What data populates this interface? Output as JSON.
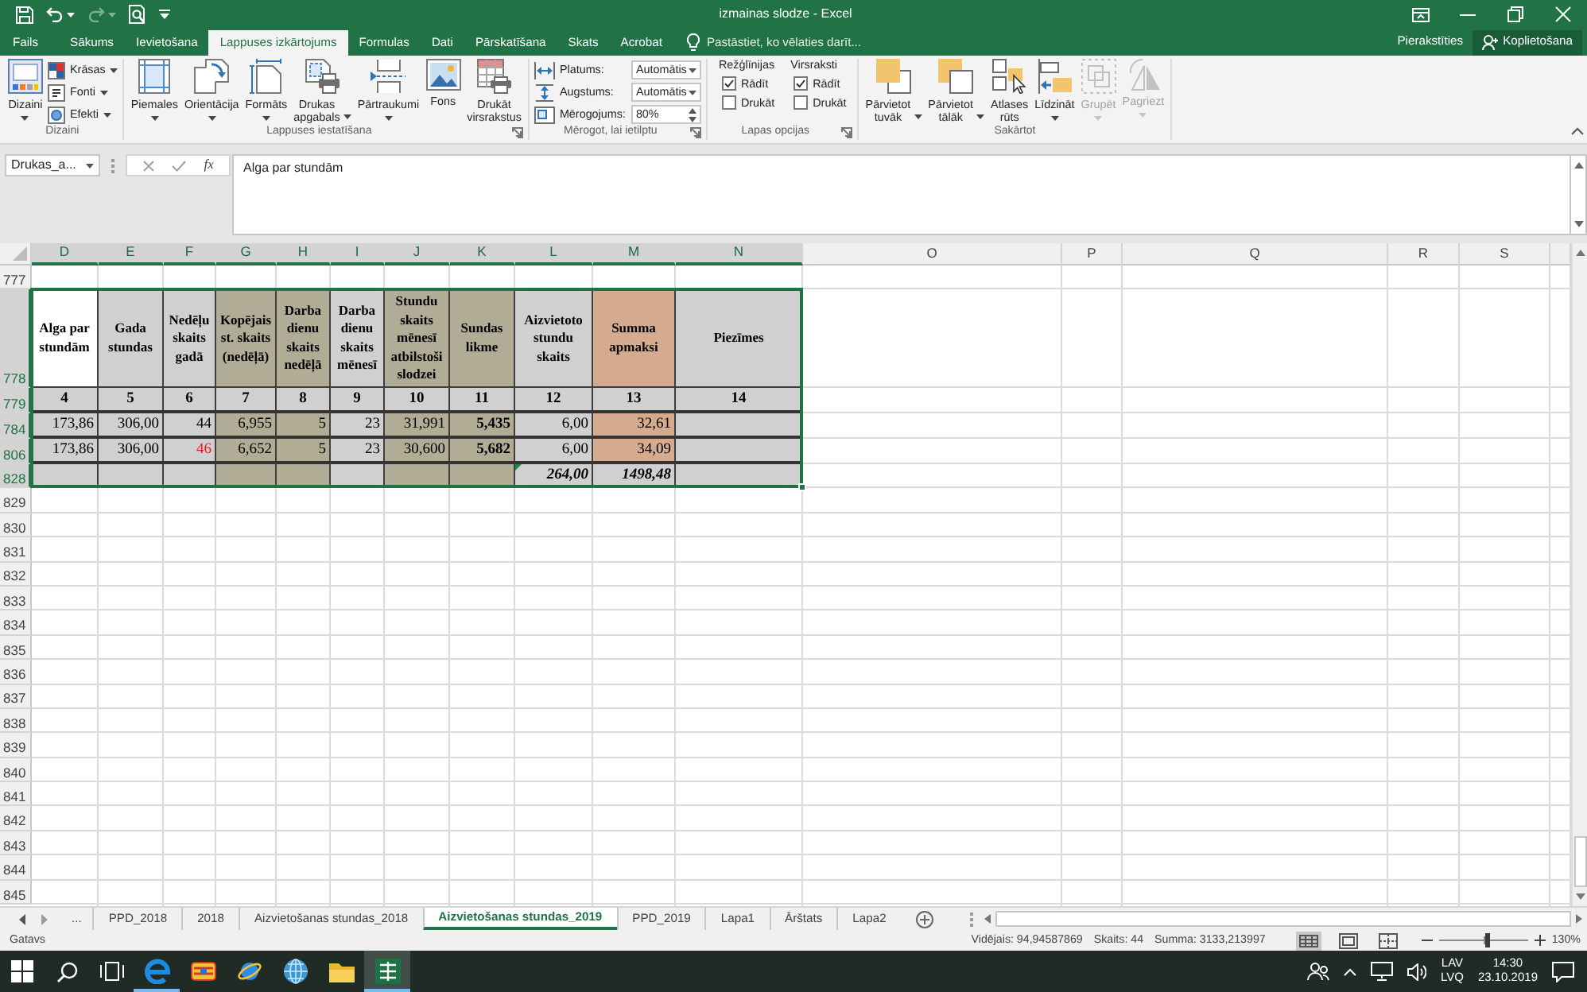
{
  "window": {
    "title": "izmainas slodze - Excel"
  },
  "quick_access": [
    {
      "disabled": false
    },
    {
      "disabled": false
    },
    {
      "disabled": true
    },
    {
      "disabled": false
    }
  ],
  "menu_tabs": [
    {
      "label": "Fails",
      "selected": false
    },
    {
      "label": "Sākums",
      "selected": false
    },
    {
      "label": "Ievietošana",
      "selected": false
    },
    {
      "label": "Lappuses izkārtojums",
      "selected": true
    },
    {
      "label": "Formulas",
      "selected": false
    },
    {
      "label": "Dati",
      "selected": false
    },
    {
      "label": "Pārskatīšana",
      "selected": false
    },
    {
      "label": "Skats",
      "selected": false
    },
    {
      "label": "Acrobat",
      "selected": false
    }
  ],
  "tell_me": {
    "placeholder": "Pastāstiet, ko vēlaties darīt..."
  },
  "account": {
    "sign_in": "Pierakstīties",
    "share": "Koplietošana"
  },
  "ribbon": {
    "groups": [
      {
        "label": "Dizaini",
        "launcher": false,
        "items": [
          {
            "kind": "large",
            "label": "Dizaini",
            "dropdown": true,
            "disabled": false
          },
          {
            "kind": "small",
            "label": "Krāsas",
            "dropdown": true,
            "disabled": false
          },
          {
            "kind": "small",
            "label": "Fonti",
            "dropdown": true,
            "disabled": false
          },
          {
            "kind": "small",
            "label": "Efekti",
            "dropdown": true,
            "disabled": false
          }
        ]
      },
      {
        "label": "Lappuses iestatīšana",
        "launcher": true,
        "items": [
          {
            "kind": "large",
            "label": "Piemales",
            "dropdown": true,
            "disabled": false
          },
          {
            "kind": "large",
            "label": "Orientācija",
            "dropdown": true,
            "disabled": false
          },
          {
            "kind": "large",
            "label": "Formāts",
            "dropdown": true,
            "disabled": false
          },
          {
            "kind": "large",
            "label": "Drukas apgabals",
            "dropdown": true,
            "disabled": false
          },
          {
            "kind": "large",
            "label": "Pārtraukumi",
            "dropdown": true,
            "disabled": false
          },
          {
            "kind": "large",
            "label": "Fons",
            "dropdown": false,
            "disabled": false
          },
          {
            "kind": "large",
            "label": "Drukāt virsrakstus",
            "dropdown": false,
            "disabled": false
          }
        ]
      },
      {
        "label": "Mērogot, lai ietilptu",
        "launcher": true,
        "items": [
          {
            "kind": "select",
            "label": "Platums:",
            "value": "Automātis"
          },
          {
            "kind": "select",
            "label": "Augstums:",
            "value": "Automātis"
          },
          {
            "kind": "spinner",
            "label": "Mērogojums:",
            "value": "80%"
          }
        ]
      },
      {
        "label": "Lapas opcijas",
        "launcher": true,
        "items": [
          {
            "kind": "checks",
            "heading": "Režģlīnijas",
            "options": [
              {
                "label": "Rādīt",
                "checked": true
              },
              {
                "label": "Drukāt",
                "checked": false
              }
            ]
          },
          {
            "kind": "checks",
            "heading": "Virsraksti",
            "options": [
              {
                "label": "Rādīt",
                "checked": true
              },
              {
                "label": "Drukāt",
                "checked": false
              }
            ]
          }
        ]
      },
      {
        "label": "Sakārtot",
        "launcher": false,
        "items": [
          {
            "kind": "large",
            "label": "Pārvietot tuvāk",
            "dropdown": true,
            "disabled": false
          },
          {
            "kind": "large",
            "label": "Pārvietot tālāk",
            "dropdown": true,
            "disabled": false
          },
          {
            "kind": "large",
            "label": "Atlases rūts",
            "dropdown": false,
            "disabled": false
          },
          {
            "kind": "large",
            "label": "Līdzināt",
            "dropdown": true,
            "disabled": false
          },
          {
            "kind": "large",
            "label": "Grupēt",
            "dropdown": true,
            "disabled": true
          },
          {
            "kind": "large",
            "label": "Pagriezt",
            "dropdown": true,
            "disabled": true
          }
        ]
      }
    ]
  },
  "formula_bar": {
    "name_box": "Drukas_a...",
    "function_button": "fx",
    "formula": "Alga par stundām"
  },
  "sheet": {
    "columns": [
      {
        "letter": "D",
        "selected": true
      },
      {
        "letter": "E",
        "selected": true
      },
      {
        "letter": "F",
        "selected": true
      },
      {
        "letter": "G",
        "selected": true
      },
      {
        "letter": "H",
        "selected": true
      },
      {
        "letter": "I",
        "selected": true
      },
      {
        "letter": "J",
        "selected": true
      },
      {
        "letter": "K",
        "selected": true
      },
      {
        "letter": "L",
        "selected": true
      },
      {
        "letter": "M",
        "selected": true
      },
      {
        "letter": "N",
        "selected": true
      },
      {
        "letter": "O",
        "selected": false
      },
      {
        "letter": "P",
        "selected": false
      },
      {
        "letter": "Q",
        "selected": false
      },
      {
        "letter": "R",
        "selected": false
      },
      {
        "letter": "S",
        "selected": false
      }
    ],
    "rows": [
      {
        "number": "777",
        "selected": false,
        "kind": "blank"
      },
      {
        "number": "778",
        "selected": true,
        "kind": "header",
        "cells": [
          {
            "text": "Alga par stundām",
            "color": "#ffffff"
          },
          {
            "text": "Gada stundas",
            "color": "#d0d0d0"
          },
          {
            "text": "Nedēļu skaits gadā",
            "color": "#d0d0d0"
          },
          {
            "text": "Kopējais st. skaits (nedēļā)",
            "color": "#b1ac96"
          },
          {
            "text": "Darba dienu skaits nedēļā",
            "color": "#b1ac96"
          },
          {
            "text": "Darba dienu skaits mēnesī",
            "color": "#d0d0d0"
          },
          {
            "text": "Stundu skaits mēnesī atbilstoši slodzei",
            "color": "#b1ac96"
          },
          {
            "text": "Sundas likme",
            "color": "#b1ac96"
          },
          {
            "text": "Aizvietoto stundu skaits",
            "color": "#d0d0d0"
          },
          {
            "text": "Summa apmaksi",
            "color": "#d5ab8f"
          },
          {
            "text": "Piezīmes",
            "color": "#d0d0d0"
          }
        ]
      },
      {
        "number": "779",
        "selected": true,
        "kind": "index",
        "cells": [
          {
            "text": "4",
            "color": "#d0d0d0"
          },
          {
            "text": "5",
            "color": "#d0d0d0"
          },
          {
            "text": "6",
            "color": "#d0d0d0"
          },
          {
            "text": "7",
            "color": "#d0d0d0"
          },
          {
            "text": "8",
            "color": "#d0d0d0"
          },
          {
            "text": "9",
            "color": "#d0d0d0"
          },
          {
            "text": "10",
            "color": "#d0d0d0"
          },
          {
            "text": "11",
            "color": "#d0d0d0"
          },
          {
            "text": "12",
            "color": "#d0d0d0"
          },
          {
            "text": "13",
            "color": "#d0d0d0"
          },
          {
            "text": "14",
            "color": "#d0d0d0"
          }
        ]
      },
      {
        "number": "784",
        "selected": true,
        "kind": "data",
        "cells": [
          {
            "text": "173,86",
            "color": "#d0d0d0",
            "kind": "plain"
          },
          {
            "text": "306,00",
            "color": "#d0d0d0",
            "kind": "plain"
          },
          {
            "text": "44",
            "color": "#d0d0d0",
            "kind": "plain"
          },
          {
            "text": "6,955",
            "color": "#b1ac96",
            "kind": "plain"
          },
          {
            "text": "5",
            "color": "#b1ac96",
            "kind": "plain"
          },
          {
            "text": "23",
            "color": "#d0d0d0",
            "kind": "plain"
          },
          {
            "text": "31,991",
            "color": "#b1ac96",
            "kind": "plain"
          },
          {
            "text": "5,435",
            "color": "#b1ac96",
            "kind": "bold"
          },
          {
            "text": "6,00",
            "color": "#d0d0d0",
            "kind": "plain"
          },
          {
            "text": "32,61",
            "color": "#d5ab8f",
            "kind": "plain"
          },
          {
            "color": "#d0d0d0"
          }
        ]
      },
      {
        "number": "806",
        "selected": true,
        "kind": "data",
        "cells": [
          {
            "text": "173,86",
            "color": "#d0d0d0",
            "kind": "plain"
          },
          {
            "text": "306,00",
            "color": "#d0d0d0",
            "kind": "plain"
          },
          {
            "text": "46",
            "color": "#d0d0d0",
            "kind": "alert"
          },
          {
            "text": "6,652",
            "color": "#b1ac96",
            "kind": "plain"
          },
          {
            "text": "5",
            "color": "#b1ac96",
            "kind": "plain"
          },
          {
            "text": "23",
            "color": "#d0d0d0",
            "kind": "plain"
          },
          {
            "text": "30,600",
            "color": "#b1ac96",
            "kind": "plain"
          },
          {
            "text": "5,682",
            "color": "#b1ac96",
            "kind": "bold"
          },
          {
            "text": "6,00",
            "color": "#d0d0d0",
            "kind": "plain"
          },
          {
            "text": "34,09",
            "color": "#d5ab8f",
            "kind": "plain"
          },
          {
            "color": "#d0d0d0"
          }
        ]
      },
      {
        "number": "828",
        "selected": true,
        "kind": "total",
        "cells": [
          {
            "color": "#d0d0d0"
          },
          {
            "color": "#d0d0d0"
          },
          {
            "color": "#d0d0d0"
          },
          {
            "color": "#b1ac96"
          },
          {
            "color": "#b1ac96"
          },
          {
            "color": "#d0d0d0"
          },
          {
            "color": "#b1ac96"
          },
          {
            "color": "#b1ac96"
          },
          {
            "text": "264,00",
            "color": "#d0d0d0",
            "kind": "emphasis",
            "error_indicator": true
          },
          {
            "text": "1498,48",
            "color": "#d0d0d0",
            "kind": "emphasis"
          },
          {
            "color": "#d0d0d0"
          }
        ]
      },
      {
        "number": "829",
        "selected": false,
        "kind": "blank"
      },
      {
        "number": "830",
        "selected": false,
        "kind": "blank"
      },
      {
        "number": "831",
        "selected": false,
        "kind": "blank"
      },
      {
        "number": "832",
        "selected": false,
        "kind": "blank"
      },
      {
        "number": "833",
        "selected": false,
        "kind": "blank"
      },
      {
        "number": "834",
        "selected": false,
        "kind": "blank"
      },
      {
        "number": "835",
        "selected": false,
        "kind": "blank"
      },
      {
        "number": "836",
        "selected": false,
        "kind": "blank"
      },
      {
        "number": "837",
        "selected": false,
        "kind": "blank"
      },
      {
        "number": "838",
        "selected": false,
        "kind": "blank"
      },
      {
        "number": "839",
        "selected": false,
        "kind": "blank"
      },
      {
        "number": "840",
        "selected": false,
        "kind": "blank"
      },
      {
        "number": "841",
        "selected": false,
        "kind": "blank"
      },
      {
        "number": "842",
        "selected": false,
        "kind": "blank"
      },
      {
        "number": "843",
        "selected": false,
        "kind": "blank"
      },
      {
        "number": "844",
        "selected": false,
        "kind": "blank"
      },
      {
        "number": "845",
        "selected": false,
        "kind": "blank"
      }
    ]
  },
  "sheet_tabs": {
    "more": "...",
    "tabs": [
      {
        "label": "PPD_2018",
        "selected": false
      },
      {
        "label": "2018",
        "selected": false
      },
      {
        "label": "Aizvietošanas stundas_2018",
        "selected": false
      },
      {
        "label": "Aizvietošanas stundas_2019",
        "selected": true
      },
      {
        "label": "PPD_2019",
        "selected": false
      },
      {
        "label": "Lapa1",
        "selected": false
      },
      {
        "label": "Ārštats",
        "selected": false
      },
      {
        "label": "Lapa2",
        "selected": false
      }
    ]
  },
  "status_bar": {
    "status": "Gatavs",
    "average": "Vidējais: 94,94587869",
    "count": "Skaits: 44",
    "sum": "Summa: 3133,213997",
    "views": [
      {
        "selected": true
      },
      {
        "selected": false
      },
      {
        "selected": false
      }
    ],
    "zoom": {
      "level": 0.55,
      "reading": "130%"
    }
  },
  "taskbar": {
    "apps": [
      {
        "running": true,
        "selected": false
      },
      {
        "running": false,
        "selected": false
      },
      {
        "running": false,
        "selected": false
      },
      {
        "running": false,
        "selected": false
      },
      {
        "running": false,
        "selected": false
      },
      {
        "running": true,
        "selected": true
      }
    ],
    "language": "LAV",
    "layout": "LVQ",
    "time": "14:30",
    "date": "23.10.2019"
  }
}
